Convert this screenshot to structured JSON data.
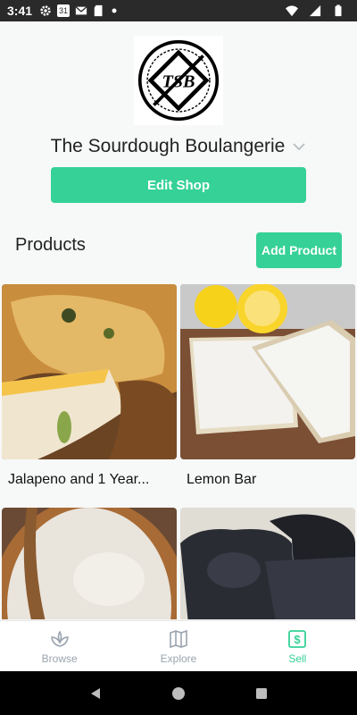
{
  "status_bar": {
    "time": "3:41",
    "left_icons": [
      "gear-icon",
      "calendar-icon",
      "mail-icon",
      "sd-card-icon",
      "dot-icon"
    ],
    "calendar_text": "31",
    "right_icons": [
      "wifi-icon",
      "signal-icon",
      "battery-icon"
    ]
  },
  "shop": {
    "logo_text": "TSB",
    "name": "The Sourdough Boulangerie",
    "edit_label": "Edit Shop"
  },
  "products": {
    "heading": "Products",
    "add_label": "Add Product",
    "items": [
      {
        "name": "Jalapeno and 1 Year...",
        "image": "cheese-bread-photo"
      },
      {
        "name": "Lemon Bar",
        "image": "lemon-bar-photo"
      },
      {
        "name": "",
        "image": "floured-sourdough-photo"
      },
      {
        "name": "",
        "image": "charcoal-bread-photo"
      }
    ]
  },
  "bottom_nav": {
    "items": [
      {
        "label": "Browse",
        "icon": "sprout-icon",
        "active": false
      },
      {
        "label": "Explore",
        "icon": "map-icon",
        "active": false
      },
      {
        "label": "Sell",
        "icon": "dollar-icon",
        "active": true
      }
    ]
  },
  "colors": {
    "accent": "#35d197",
    "inactive": "#9aa3ad",
    "background": "#f7f8f8"
  }
}
